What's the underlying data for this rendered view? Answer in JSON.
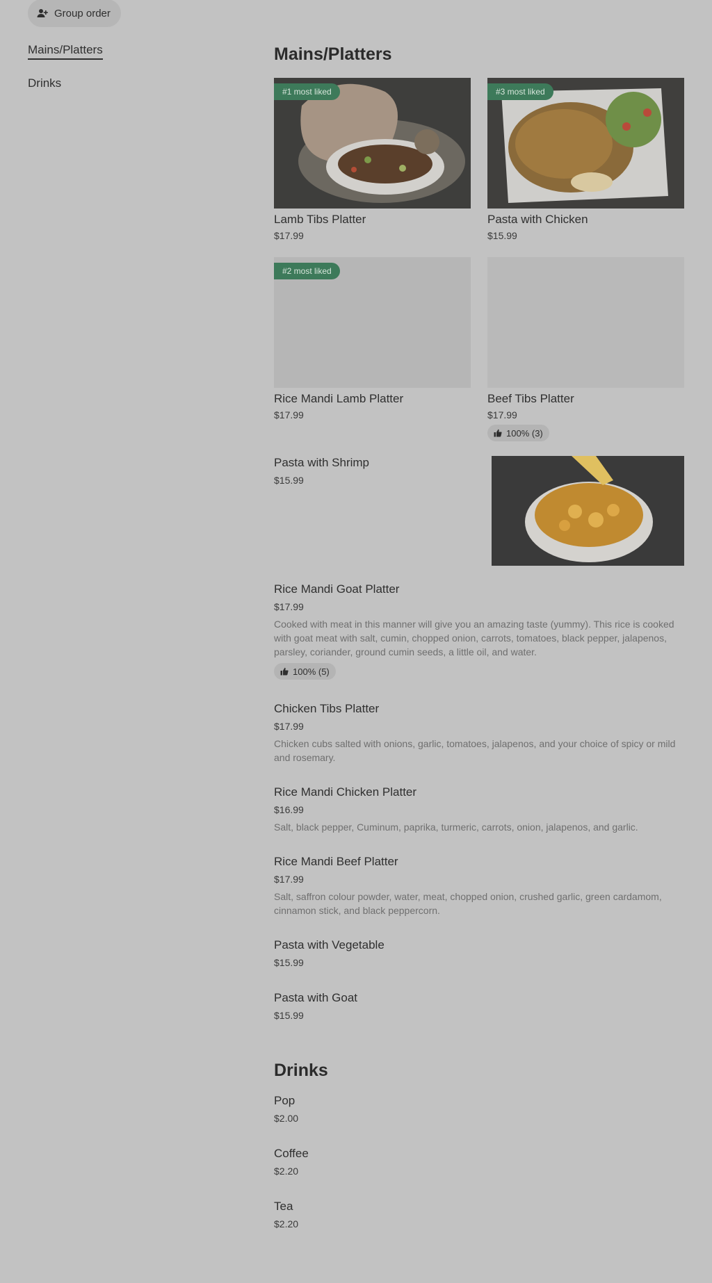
{
  "group_order": {
    "label": "Group order",
    "icon": "person-plus-icon"
  },
  "sidenav": [
    {
      "label": "Mains/Platters"
    },
    {
      "label": "Drinks"
    }
  ],
  "sections": {
    "mains_title": "Mains/Platters",
    "drinks_title": "Drinks"
  },
  "cards": [
    {
      "name": "Lamb Tibs Platter",
      "price": "$17.99",
      "badge": "#1 most liked"
    },
    {
      "name": "Pasta with Chicken",
      "price": "$15.99",
      "badge": "#3 most liked"
    },
    {
      "name": "Rice Mandi Lamb Platter",
      "price": "$17.99",
      "badge": "#2 most liked"
    },
    {
      "name": "Beef Tibs Platter",
      "price": "$17.99",
      "rating": "100% (3)"
    }
  ],
  "list_items": [
    {
      "name": "Pasta with Shrimp",
      "price": "$15.99"
    },
    {
      "name": "Rice Mandi Goat Platter",
      "price": "$17.99",
      "desc": "Cooked with meat in this manner will give you an amazing taste (yummy). This rice is cooked with goat meat with salt, cumin, chopped onion, carrots, tomatoes, black pepper, jalapenos, parsley, coriander, ground cumin seeds, a little oil, and water.",
      "rating": "100% (5)"
    },
    {
      "name": "Chicken Tibs Platter",
      "price": "$17.99",
      "desc": "Chicken cubs salted with onions, garlic, tomatoes, jalapenos, and your choice of spicy or mild and rosemary."
    },
    {
      "name": "Rice Mandi Chicken Platter",
      "price": "$16.99",
      "desc": "Salt, black pepper, Cuminum, paprika, turmeric, carrots, onion, jalapenos, and garlic."
    },
    {
      "name": "Rice Mandi Beef Platter",
      "price": "$17.99",
      "desc": "Salt, saffron colour powder, water, meat, chopped onion, crushed garlic, green cardamom, cinnamon stick, and black peppercorn."
    },
    {
      "name": "Pasta with Vegetable",
      "price": "$15.99"
    },
    {
      "name": "Pasta with Goat",
      "price": "$15.99"
    }
  ],
  "drinks": [
    {
      "name": "Pop",
      "price": "$2.00"
    },
    {
      "name": "Coffee",
      "price": "$2.20"
    },
    {
      "name": "Tea",
      "price": "$2.20"
    }
  ]
}
